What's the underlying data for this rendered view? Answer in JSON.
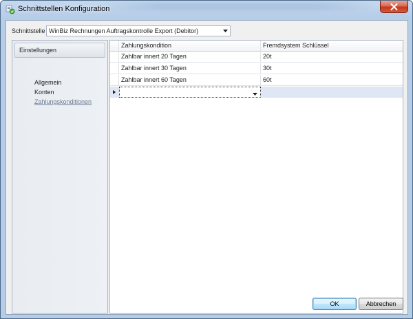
{
  "window": {
    "title": "Schnittstellen Konfiguration",
    "close_label": "✕"
  },
  "interface": {
    "label": "Schnittstelle",
    "selected": "WinBiz Rechnungen Auftragskontrolle Export (Debitor)"
  },
  "sidebar": {
    "header": "Einstellungen",
    "items": [
      {
        "label": "Allgemein"
      },
      {
        "label": "Konten"
      },
      {
        "label": "Zahlungskonditionen",
        "active": true
      }
    ]
  },
  "grid": {
    "columns": [
      "Zahlungskondition",
      "Fremdsystem Schlüssel"
    ],
    "rows": [
      {
        "condition": "Zahlbar innert 20 Tagen",
        "key": "20t"
      },
      {
        "condition": "Zahlbar innert 30 Tagen",
        "key": "30t"
      },
      {
        "condition": "Zahlbar innert 60 Tagen",
        "key": "60t"
      }
    ],
    "new_row": {
      "condition": "",
      "key": ""
    }
  },
  "buttons": {
    "ok": "OK",
    "cancel": "Abbrechen"
  },
  "colors": {
    "accent": "#3c7fb1",
    "close": "#c3391f",
    "active_link": "#6b7d93"
  }
}
